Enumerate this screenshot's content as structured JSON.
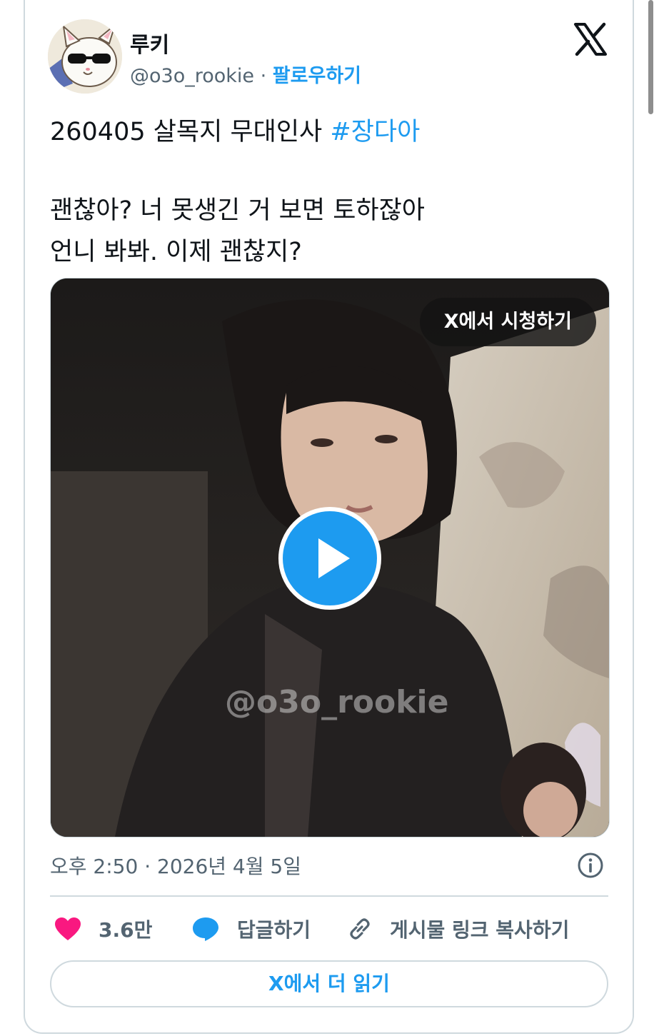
{
  "author": {
    "name": "루키",
    "handle": "@o3o_rookie",
    "separator": "·",
    "follow_label": "팔로우하기"
  },
  "tweet": {
    "line1_text": "260405 살목지 무대인사 ",
    "line1_hashtag": "#장다아",
    "line2": "괜찮아? 너 못생긴 거 보면 토하잖아",
    "line3": "언니 봐봐. 이제 괜찮지?"
  },
  "media": {
    "watch_label": "X에서 시청하기",
    "watermark": "@o3o_rookie"
  },
  "meta": {
    "timestamp": "오후 2:50 · 2026년 4월 5일"
  },
  "actions": {
    "like_count": "3.6만",
    "reply_label": "답글하기",
    "copy_link_label": "게시물 링크 복사하기"
  },
  "read_more_label": "X에서 더 읽기",
  "colors": {
    "accent": "#1d9bf0",
    "like": "#f91880",
    "text_secondary": "#536471",
    "border": "#cfd9de"
  },
  "icons": [
    "x-logo-icon",
    "play-icon",
    "info-icon",
    "heart-icon",
    "reply-icon",
    "link-icon"
  ]
}
